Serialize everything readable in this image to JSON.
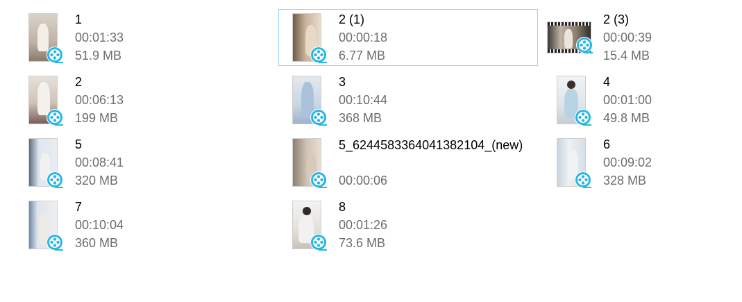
{
  "files": [
    {
      "name": "1",
      "duration": "00:01:33",
      "size": "51.9 MB",
      "thumb_color": "#cfc3b8"
    },
    {
      "name": "2  (1)",
      "duration": "00:00:18",
      "size": "6.77 MB",
      "thumb_color": "#b9a28a",
      "selected": true
    },
    {
      "name": "2  (3)",
      "duration": "00:00:39",
      "size": "15.4 MB",
      "thumb_color": "#a39582",
      "landscape": true
    },
    {
      "name": "2",
      "duration": "00:06:13",
      "size": "199 MB",
      "thumb_color": "#d8cdc3"
    },
    {
      "name": "3",
      "duration": "00:10:44",
      "size": "368 MB",
      "thumb_color": "#c4d3e0"
    },
    {
      "name": "4",
      "duration": "00:01:00",
      "size": "49.8 MB",
      "thumb_color": "#dfe4e8"
    },
    {
      "name": "5",
      "duration": "00:08:41",
      "size": "320 MB",
      "thumb_color": "#d6dde6"
    },
    {
      "name": "5_6244583364041382104_(new)",
      "duration": "00:00:06",
      "size": "",
      "thumb_color": "#b7aa9c"
    },
    {
      "name": "6",
      "duration": "00:09:02",
      "size": "328 MB",
      "thumb_color": "#d4dde6"
    },
    {
      "name": "7",
      "duration": "00:10:04",
      "size": "360 MB",
      "thumb_color": "#d0d8e2"
    },
    {
      "name": "8",
      "duration": "00:01:26",
      "size": "73.6 MB",
      "thumb_color": "#e3e1de"
    }
  ],
  "icons": {
    "video_badge": "film-reel-icon"
  },
  "colors": {
    "selection_border": "#99d1ff",
    "secondary_text": "#6d6d6d",
    "badge_blue": "#29b6e6"
  }
}
